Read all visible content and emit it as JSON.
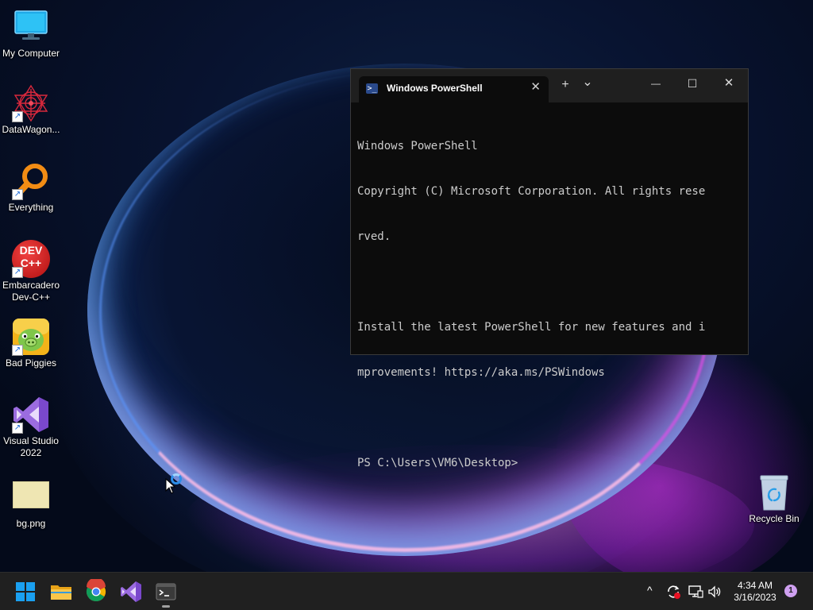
{
  "desktop": {
    "icons": [
      {
        "label": "My Computer",
        "icon": "monitor-icon"
      },
      {
        "label": "DataWagon...",
        "icon": "datawagon-icon"
      },
      {
        "label": "Everything",
        "icon": "everything-search-icon"
      },
      {
        "label": "Embarcadero Dev-C++",
        "icon": "devcpp-icon"
      },
      {
        "label": "Bad Piggies",
        "icon": "bad-piggies-icon"
      },
      {
        "label": "Visual Studio 2022",
        "icon": "visual-studio-icon"
      },
      {
        "label": "bg.png",
        "icon": "image-file-icon"
      },
      {
        "label": "Recycle Bin",
        "icon": "recycle-bin-icon"
      }
    ],
    "icon_glyphs": {
      "devcpp_line1": "DEV",
      "devcpp_line2": "C++",
      "shortcut_arrow": "↗"
    }
  },
  "terminal": {
    "tab_title": "Windows PowerShell",
    "tab_icon_glyph": ">_",
    "tab_close": "✕",
    "new_tab": "+",
    "dropdown": "⌄",
    "minimize": "—",
    "maximize": "☐",
    "close": "✕",
    "lines": [
      "Windows PowerShell",
      "Copyright (C) Microsoft Corporation. All rights rese",
      "rved.",
      "",
      "Install the latest PowerShell for new features and i",
      "mprovements! https://aka.ms/PSWindows",
      "",
      "PS C:\\Users\\VM6\\Desktop>"
    ]
  },
  "taskbar": {
    "apps": [
      {
        "name": "start",
        "icon": "windows-logo-icon"
      },
      {
        "name": "file-explorer",
        "icon": "folder-icon"
      },
      {
        "name": "chrome",
        "icon": "chrome-icon"
      },
      {
        "name": "visual-studio",
        "icon": "visual-studio-icon"
      },
      {
        "name": "terminal",
        "icon": "terminal-icon",
        "active": true
      }
    ],
    "tray": {
      "chevron": "^",
      "time": "4:34 AM",
      "date": "3/16/2023",
      "notification_count": "1"
    }
  },
  "colors": {
    "taskbar": "#202020",
    "terminal_bg": "#0c0c0c",
    "terminal_text": "#cccccc",
    "accent_blue": "#2b8de8",
    "notification_badge": "#cfa0f0"
  }
}
